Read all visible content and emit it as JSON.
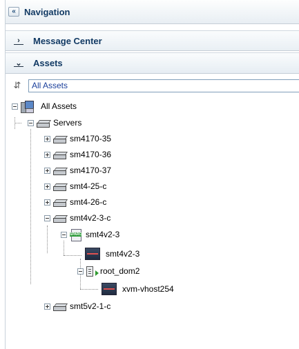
{
  "navigation": {
    "title": "Navigation",
    "collapse_icon": "double-chevron-left-icon"
  },
  "sections": {
    "message_center": {
      "label": "Message Center",
      "expanded": false
    },
    "assets": {
      "label": "Assets",
      "expanded": true
    }
  },
  "assets_selector": {
    "refresh_icon": "refresh-icon",
    "selected": "All Assets"
  },
  "tree": {
    "root": {
      "label": "All Assets",
      "icon": "assets-icon"
    },
    "servers": {
      "label": "Servers",
      "icon": "server-icon"
    },
    "items": [
      {
        "label": "sm4170-35",
        "icon": "server-icon"
      },
      {
        "label": "sm4170-36",
        "icon": "server-icon"
      },
      {
        "label": "sm4170-37",
        "icon": "server-icon"
      },
      {
        "label": "smt4-25-c",
        "icon": "server-icon"
      },
      {
        "label": "smt4-26-c",
        "icon": "server-icon"
      },
      {
        "label": "smt4v2-3-c",
        "icon": "server-icon"
      }
    ],
    "host": {
      "label": "smt4v2-3",
      "icon": "host-icon"
    },
    "host_child": {
      "label": "smt4v2-3",
      "icon": "vm-icon"
    },
    "domain": {
      "label": "root_dom2",
      "icon": "domain-icon"
    },
    "domain_child": {
      "label": "xvm-vhost254",
      "icon": "vm-icon"
    },
    "last": {
      "label": "smt5v2-1-c",
      "icon": "server-icon"
    }
  },
  "colors": {
    "header_text": "#123a64",
    "select_text": "#1a3f9b",
    "panel_border": "#c9d2da"
  }
}
